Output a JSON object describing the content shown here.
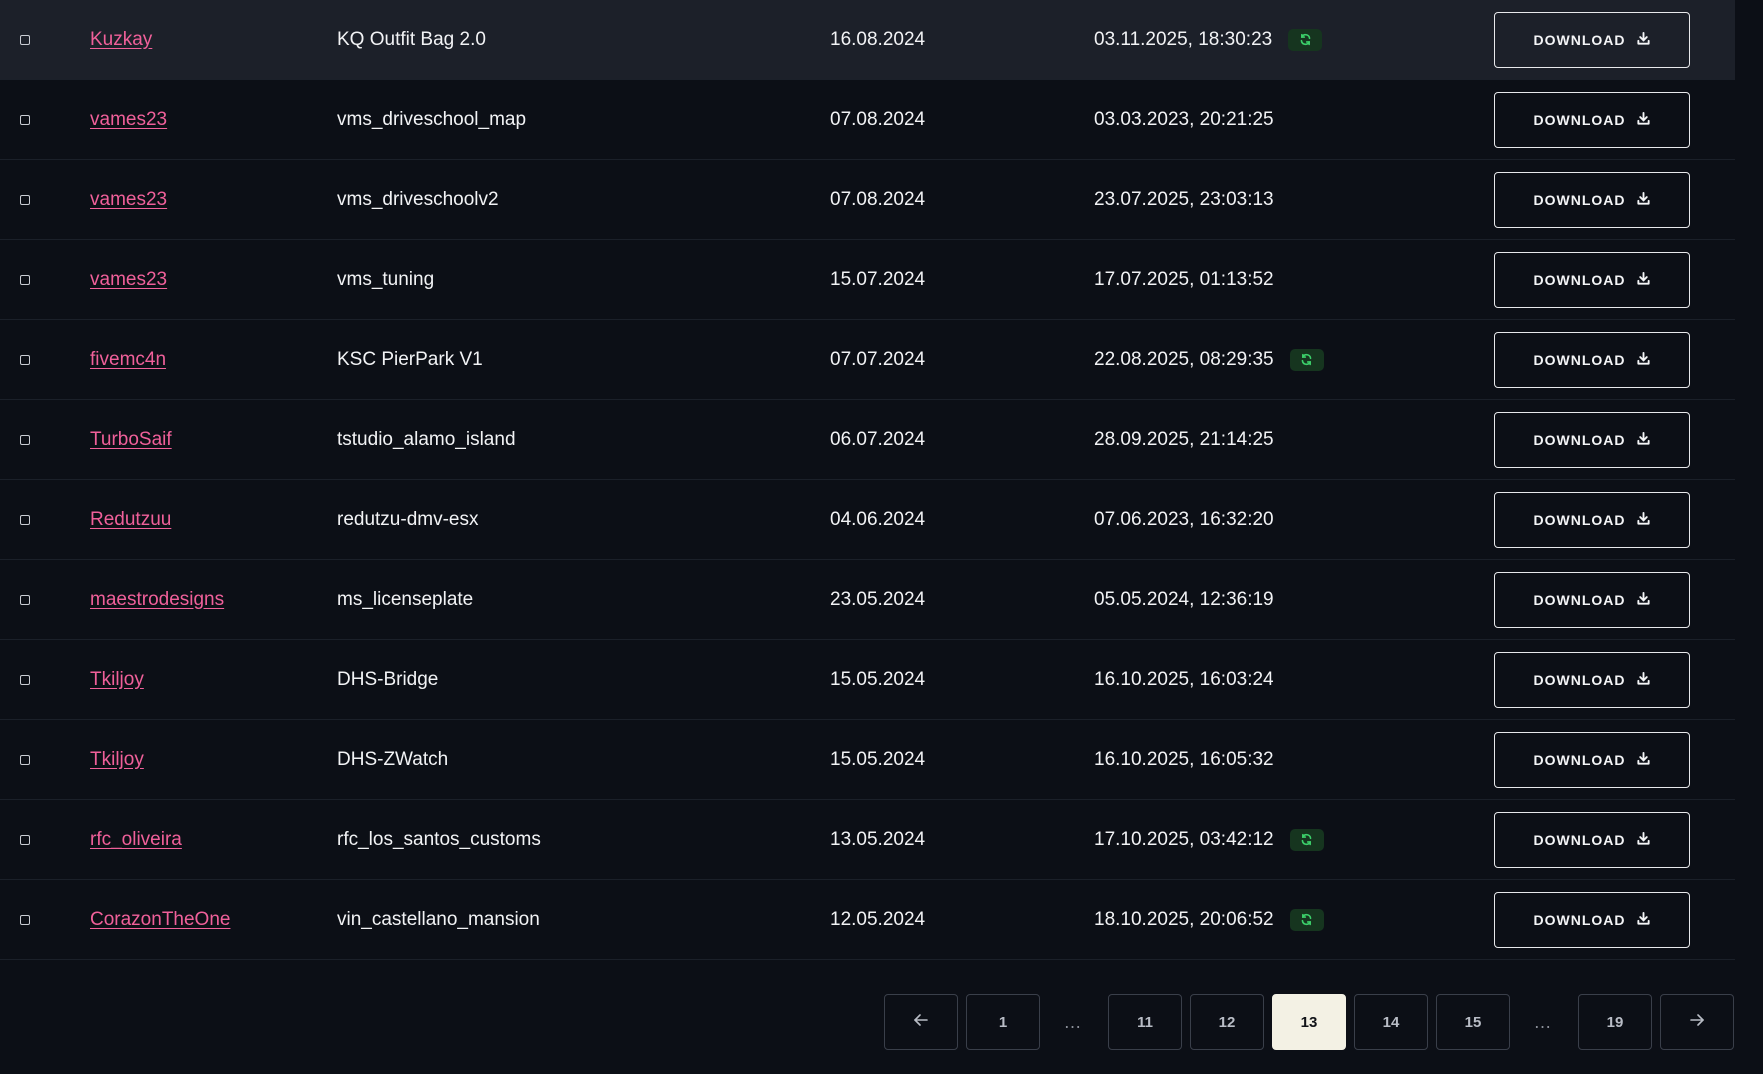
{
  "rows": [
    {
      "author": "Kuzkay",
      "name": "KQ Outfit Bag 2.0",
      "date": "16.08.2024",
      "updated": "03.11.2025, 18:30:23",
      "synced": true,
      "active": true
    },
    {
      "author": "vames23",
      "name": "vms_driveschool_map",
      "date": "07.08.2024",
      "updated": "03.03.2023, 20:21:25",
      "synced": false
    },
    {
      "author": "vames23",
      "name": "vms_driveschoolv2",
      "date": "07.08.2024",
      "updated": "23.07.2025, 23:03:13",
      "synced": false
    },
    {
      "author": "vames23",
      "name": "vms_tuning",
      "date": "15.07.2024",
      "updated": "17.07.2025, 01:13:52",
      "synced": false
    },
    {
      "author": "fivemc4n",
      "name": "KSC PierPark V1",
      "date": "07.07.2024",
      "updated": "22.08.2025, 08:29:35",
      "synced": true
    },
    {
      "author": "TurboSaif",
      "name": "tstudio_alamo_island",
      "date": "06.07.2024",
      "updated": "28.09.2025, 21:14:25",
      "synced": false
    },
    {
      "author": "Redutzuu",
      "name": "redutzu-dmv-esx",
      "date": "04.06.2024",
      "updated": "07.06.2023, 16:32:20",
      "synced": false
    },
    {
      "author": "maestrodesigns",
      "name": "ms_licenseplate",
      "date": "23.05.2024",
      "updated": "05.05.2024, 12:36:19",
      "synced": false
    },
    {
      "author": "Tkiljoy",
      "name": "DHS-Bridge",
      "date": "15.05.2024",
      "updated": "16.10.2025, 16:03:24",
      "synced": false
    },
    {
      "author": "Tkiljoy",
      "name": "DHS-ZWatch",
      "date": "15.05.2024",
      "updated": "16.10.2025, 16:05:32",
      "synced": false
    },
    {
      "author": "rfc_oliveira",
      "name": "rfc_los_santos_customs",
      "date": "13.05.2024",
      "updated": "17.10.2025, 03:42:12",
      "synced": true
    },
    {
      "author": "CorazonTheOne",
      "name": "vin_castellano_mansion",
      "date": "12.05.2024",
      "updated": "18.10.2025, 20:06:52",
      "synced": true
    }
  ],
  "download_label": "DOWNLOAD",
  "icons": {
    "download": "download-icon",
    "sync": "refresh-icon",
    "prev": "arrow-left-icon",
    "next": "arrow-right-icon"
  },
  "colors": {
    "author_link": "#f0609a",
    "sync_green": "#3ccf6a",
    "current_page_bg": "#f3f1e4"
  },
  "pagination": {
    "items": [
      "1",
      "…",
      "11",
      "12",
      "13",
      "14",
      "15",
      "…",
      "19"
    ],
    "current": "13"
  }
}
